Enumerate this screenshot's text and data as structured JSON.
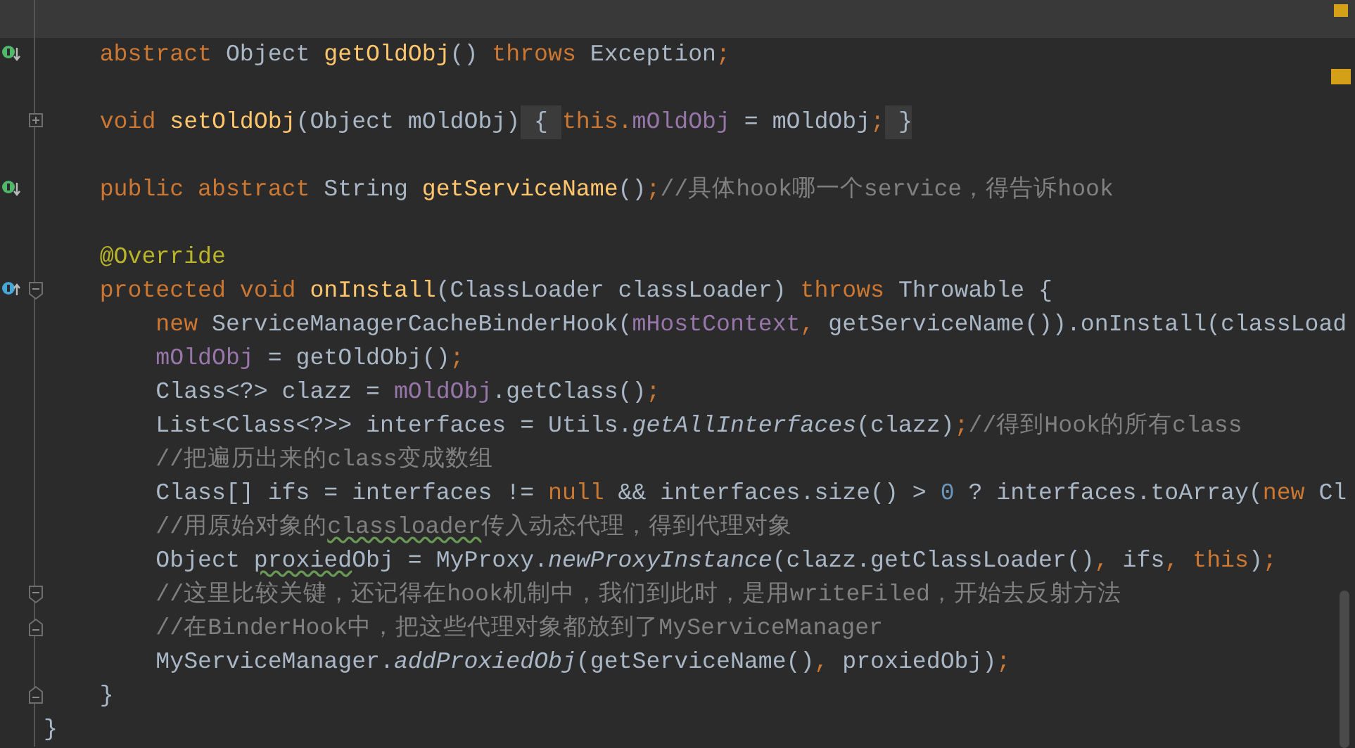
{
  "editor": {
    "lines": [
      {
        "kind": "blank",
        "current": true
      },
      {
        "gutter_marker": {
          "kind": "implemented"
        },
        "tokens": [
          {
            "kind": "keyword",
            "text": "    abstract"
          },
          {
            "kind": "plain",
            "text": " Object "
          },
          {
            "kind": "method",
            "text": "getOldObj"
          },
          {
            "kind": "plain",
            "text": "() "
          },
          {
            "kind": "keyword",
            "text": "throws"
          },
          {
            "kind": "plain",
            "text": " Exception"
          },
          {
            "kind": "punct",
            "text": ";"
          }
        ]
      },
      {
        "kind": "blank"
      },
      {
        "fold_marker": {
          "kind": "expand"
        },
        "tokens": [
          {
            "kind": "keyword",
            "text": "    void "
          },
          {
            "kind": "method",
            "text": "setOldObj"
          },
          {
            "kind": "plain",
            "text": "(Object mOldObj)"
          },
          {
            "kind": "plain",
            "text": " { ",
            "folded": true
          },
          {
            "kind": "keyword",
            "text": "this."
          },
          {
            "kind": "field",
            "text": "mOldObj"
          },
          {
            "kind": "plain",
            "text": " = mOldObj"
          },
          {
            "kind": "punct",
            "text": ";"
          },
          {
            "kind": "plain",
            "text": " }",
            "folded": true
          }
        ]
      },
      {
        "kind": "blank"
      },
      {
        "gutter_marker": {
          "kind": "implemented"
        },
        "tokens": [
          {
            "kind": "keyword",
            "text": "    public abstract"
          },
          {
            "kind": "plain",
            "text": " String "
          },
          {
            "kind": "method",
            "text": "getServiceName"
          },
          {
            "kind": "plain",
            "text": "()"
          },
          {
            "kind": "punct",
            "text": ";"
          },
          {
            "kind": "comment",
            "text": "//具体hook哪一个service，得告诉hook"
          }
        ]
      },
      {
        "kind": "blank"
      },
      {
        "tokens": [
          {
            "kind": "annotation",
            "text": "    @Override"
          }
        ]
      },
      {
        "gutter_marker": {
          "kind": "overrides"
        },
        "fold_marker": {
          "kind": "collapse"
        },
        "tokens": [
          {
            "kind": "keyword",
            "text": "    protected void "
          },
          {
            "kind": "method",
            "text": "onInstall"
          },
          {
            "kind": "plain",
            "text": "(ClassLoader classLoader) "
          },
          {
            "kind": "keyword",
            "text": "throws"
          },
          {
            "kind": "plain",
            "text": " Throwable {"
          }
        ]
      },
      {
        "tokens": [
          {
            "kind": "keyword",
            "text": "        new"
          },
          {
            "kind": "plain",
            "text": " ServiceManagerCacheBinderHook("
          },
          {
            "kind": "field",
            "text": "mHostContext"
          },
          {
            "kind": "punct",
            "text": ","
          },
          {
            "kind": "plain",
            "text": " getServiceName()).onInstall(classLoad"
          }
        ]
      },
      {
        "tokens": [
          {
            "kind": "field",
            "text": "        mOldObj"
          },
          {
            "kind": "plain",
            "text": " = getOldObj()"
          },
          {
            "kind": "punct",
            "text": ";"
          }
        ]
      },
      {
        "tokens": [
          {
            "kind": "plain",
            "text": "        Class<?> clazz = "
          },
          {
            "kind": "field",
            "text": "mOldObj"
          },
          {
            "kind": "plain",
            "text": ".getClass()"
          },
          {
            "kind": "punct",
            "text": ";"
          }
        ]
      },
      {
        "tokens": [
          {
            "kind": "plain",
            "text": "        List<Class<?>> interfaces = Utils."
          },
          {
            "kind": "static_call",
            "text": "getAllInterfaces"
          },
          {
            "kind": "plain",
            "text": "(clazz)"
          },
          {
            "kind": "punct",
            "text": ";"
          },
          {
            "kind": "comment",
            "text": "//得到Hook的所有class"
          }
        ]
      },
      {
        "tokens": [
          {
            "kind": "comment",
            "text": "        //把遍历出来的class变成数组"
          }
        ]
      },
      {
        "tokens": [
          {
            "kind": "plain",
            "text": "        Class[] ifs = interfaces != "
          },
          {
            "kind": "keyword",
            "text": "null"
          },
          {
            "kind": "plain",
            "text": " && interfaces.size() > "
          },
          {
            "kind": "number",
            "text": "0"
          },
          {
            "kind": "plain",
            "text": " ? interfaces.toArray("
          },
          {
            "kind": "keyword",
            "text": "new"
          },
          {
            "kind": "plain",
            "text": " Cl"
          }
        ]
      },
      {
        "tokens": [
          {
            "kind": "comment",
            "text": "        //用原始对象的"
          },
          {
            "kind": "comment",
            "text": "classloader",
            "typo": true
          },
          {
            "kind": "comment",
            "text": "传入动态代理，得到代理对象"
          }
        ]
      },
      {
        "tokens": [
          {
            "kind": "plain",
            "text": "        Object "
          },
          {
            "kind": "plain",
            "text": "proxied",
            "typo": true
          },
          {
            "kind": "plain",
            "text": "Obj = MyProxy."
          },
          {
            "kind": "static_call",
            "text": "newProxyInstance"
          },
          {
            "kind": "plain",
            "text": "(clazz.getClassLoader()"
          },
          {
            "kind": "punct",
            "text": ","
          },
          {
            "kind": "plain",
            "text": " ifs"
          },
          {
            "kind": "punct",
            "text": ", "
          },
          {
            "kind": "keyword",
            "text": "this"
          },
          {
            "kind": "plain",
            "text": ")"
          },
          {
            "kind": "punct",
            "text": ";"
          }
        ]
      },
      {
        "fold_marker": {
          "kind": "collapse"
        },
        "tokens": [
          {
            "kind": "comment",
            "text": "        //这里比较关键，还记得在hook机制中，我们到此时，是用writeFiled，开始去反射方法"
          }
        ]
      },
      {
        "fold_marker": {
          "kind": "end"
        },
        "tokens": [
          {
            "kind": "comment",
            "text": "        //在BinderHook中，把这些代理对象都放到了MyServiceManager"
          }
        ]
      },
      {
        "tokens": [
          {
            "kind": "plain",
            "text": "        MyServiceManager."
          },
          {
            "kind": "static_call",
            "text": "addProxiedObj"
          },
          {
            "kind": "plain",
            "text": "(getServiceName()"
          },
          {
            "kind": "punct",
            "text": ","
          },
          {
            "kind": "plain",
            "text": " proxiedObj)"
          },
          {
            "kind": "punct",
            "text": ";"
          }
        ]
      },
      {
        "fold_marker": {
          "kind": "end"
        },
        "tokens": [
          {
            "kind": "plain",
            "text": "    }"
          }
        ]
      },
      {
        "tokens": [
          {
            "kind": "plain",
            "text": "}"
          }
        ]
      }
    ]
  }
}
